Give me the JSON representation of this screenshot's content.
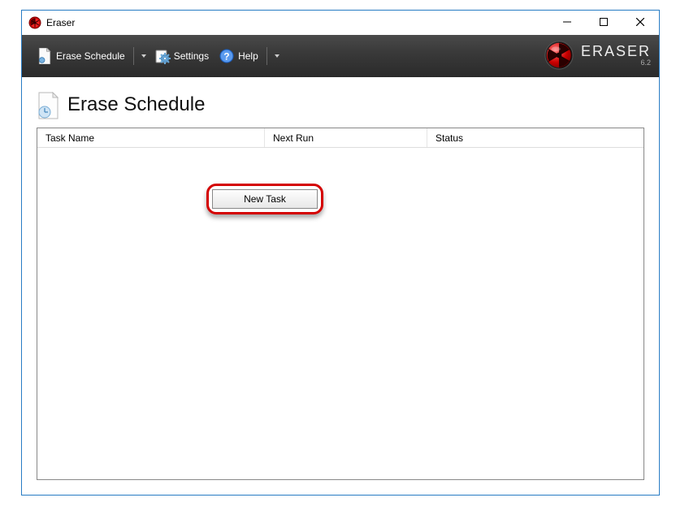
{
  "window": {
    "title": "Eraser"
  },
  "toolbar": {
    "erase_schedule_label": "Erase Schedule",
    "settings_label": "Settings",
    "help_label": "Help"
  },
  "brand": {
    "name": "ERASER",
    "version": "6.2"
  },
  "page": {
    "title": "Erase Schedule"
  },
  "columns": {
    "task_name": "Task Name",
    "next_run": "Next Run",
    "status": "Status"
  },
  "context_menu": {
    "new_task": "New Task"
  }
}
